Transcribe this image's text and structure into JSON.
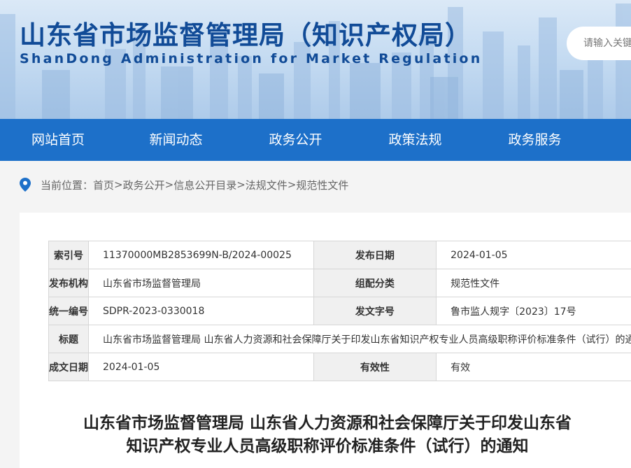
{
  "header": {
    "title": "山东省市场监督管理局（知识产权局）",
    "subtitle": "ShanDong Administration for Market Regulation",
    "search_placeholder": "请输入关键字"
  },
  "nav": {
    "items": [
      {
        "label": "网站首页"
      },
      {
        "label": "新闻动态"
      },
      {
        "label": "政务公开"
      },
      {
        "label": "政策法规"
      },
      {
        "label": "政务服务"
      }
    ]
  },
  "breadcrumb": {
    "prefix": "当前位置：",
    "items": [
      "首页",
      "政务公开",
      "信息公开目录",
      "法规文件",
      "规范性文件"
    ],
    "separator": ">"
  },
  "meta": {
    "index_label": "索引号",
    "index_value": "11370000MB2853699N-B/2024-00025",
    "pub_date_label": "发布日期",
    "pub_date_value": "2024-01-05",
    "org_label": "发布机构",
    "org_value": "山东省市场监督管理局",
    "category_label": "组配分类",
    "category_value": "规范性文件",
    "code_label": "统一编号",
    "code_value": "SDPR-2023-0330018",
    "doc_no_label": "发文字号",
    "doc_no_value": "鲁市监人规字〔2023〕17号",
    "title_label": "标题",
    "title_value": "山东省市场监督管理局 山东省人力资源和社会保障厅关于印发山东省知识产权专业人员高级职称评价标准条件（试行）的通知",
    "created_label": "成文日期",
    "created_value": "2024-01-05",
    "validity_label": "有效性",
    "validity_value": "有效"
  },
  "document": {
    "title_line1": "山东省市场监督管理局 山东省人力资源和社会保障厅关于印发山东省",
    "title_line2": "知识产权专业人员高级职称评价标准条件（试行）的通知"
  },
  "colors": {
    "brand_blue": "#114b97",
    "nav_blue": "#1d70c9",
    "pin_blue": "#1d70c9"
  }
}
